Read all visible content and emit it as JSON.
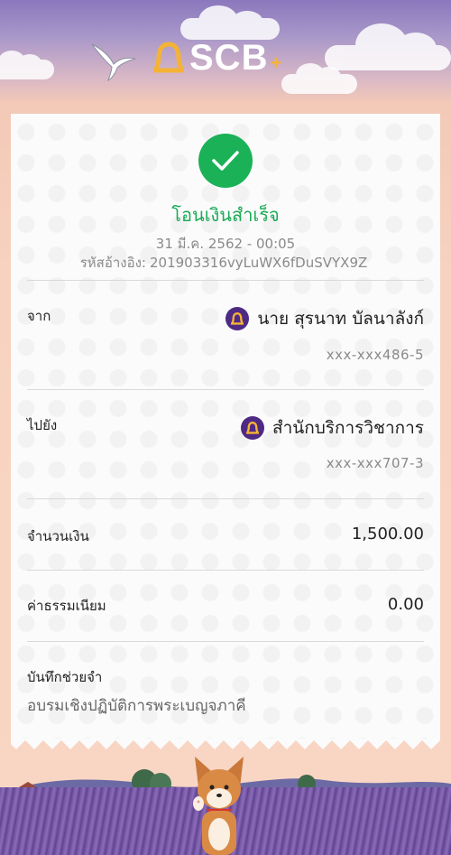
{
  "brand": {
    "name": "SCB",
    "plus": "+"
  },
  "receipt": {
    "status": "โอนเงินสำเร็จ",
    "datetime": "31 มี.ค. 2562 - 00:05",
    "ref_label": "รหัสอ้างอิง:",
    "ref_code": "201903316vyLuWX6fDuSVYX9Z",
    "from": {
      "label": "จาก",
      "name": "นาย สุรนาท บัลนาลังก์",
      "account": "xxx-xxx486-5",
      "icon": "scb-bank-icon"
    },
    "to": {
      "label": "ไปยัง",
      "name": "สำนักบริการวิชาการ",
      "account": "xxx-xxx707-3",
      "icon": "scb-bank-icon"
    },
    "amount": {
      "label": "จำนวนเงิน",
      "value": "1,500.00"
    },
    "fee": {
      "label": "ค่าธรรมเนียม",
      "value": "0.00"
    },
    "memo": {
      "label": "บันทึกช่วยจำ",
      "value": "อบรมเชิงปฏิบัติการพระเบญจภาคี"
    }
  },
  "colors": {
    "success": "#1bb157",
    "bank_purple": "#4e2a84",
    "brand_gold": "#f5b335"
  }
}
